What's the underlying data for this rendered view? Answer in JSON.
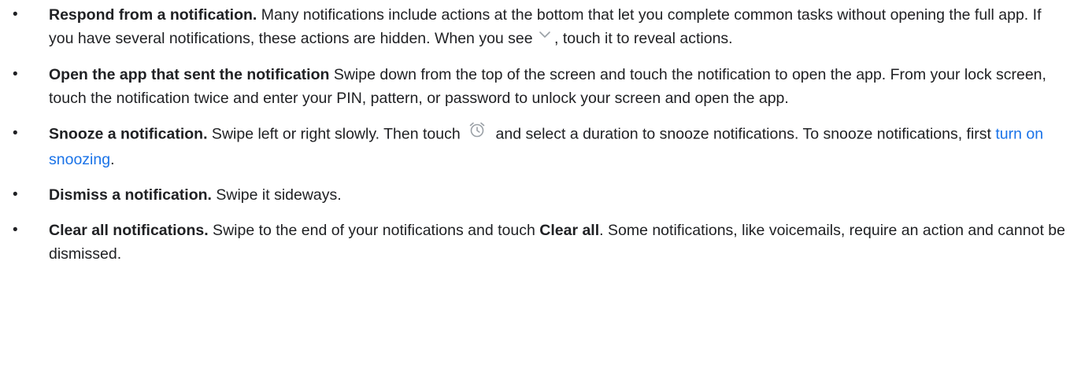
{
  "items": [
    {
      "heading": "Respond from a notification.",
      "text_before_icon": " Many notifications include actions at the bottom that let you complete common tasks without opening the full app. If you have several notifications, these actions are hidden. When you see ",
      "icon": "chevron-down-icon",
      "text_after_icon": ", touch it to reveal actions."
    },
    {
      "heading": "Open the app that sent the notification",
      "text": " Swipe down from the top of the screen and touch the notification to open the app. From your lock screen, touch the notification twice and enter your PIN, pattern, or password to unlock your screen and open the app."
    },
    {
      "heading": "Snooze a notification.",
      "text_before_icon": " Swipe left or right slowly. Then touch ",
      "icon": "alarm-clock-icon",
      "text_after_icon": " and select a duration to snooze notifications. To snooze notifications, first ",
      "link_text": "turn on snoozing",
      "text_after_link": "."
    },
    {
      "heading": "Dismiss a notification.",
      "text": " Swipe it sideways."
    },
    {
      "heading": "Clear all notifications.",
      "text_before_bold": " Swipe to the end of your notifications and touch ",
      "bold_text": "Clear all",
      "text_after_bold": ". Some notifications, like voicemails, require an action and cannot be dismissed."
    }
  ],
  "bullet_char": "•",
  "colors": {
    "text": "#202124",
    "link": "#1a73e8",
    "icon": "#9aa0a6"
  }
}
